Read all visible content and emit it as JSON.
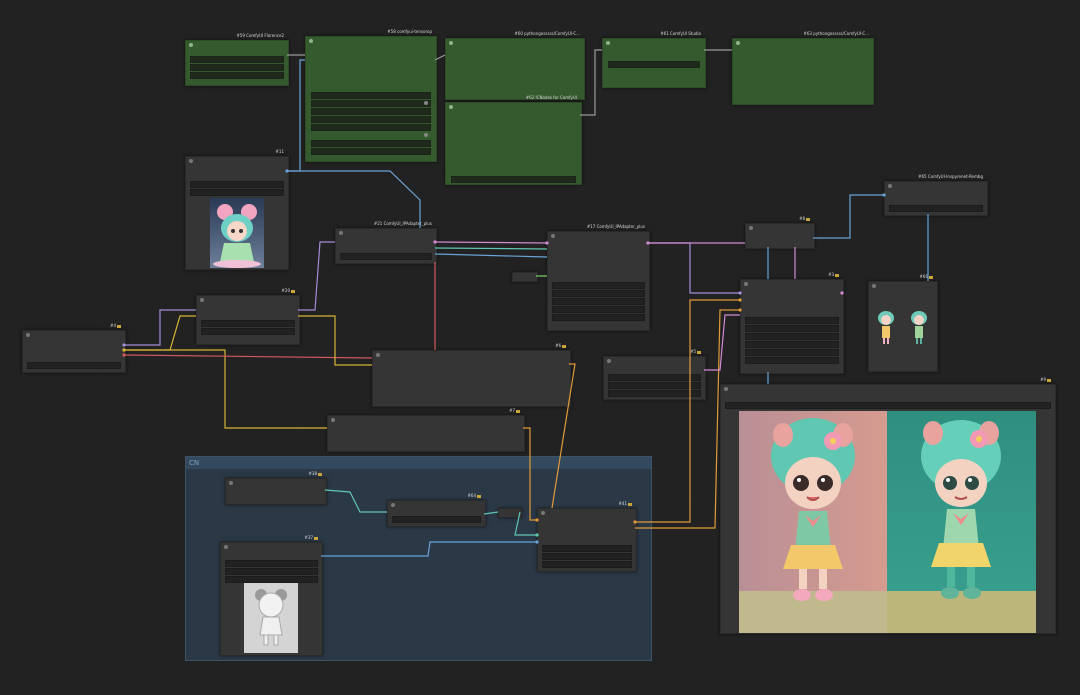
{
  "group": {
    "title": "CN"
  },
  "nodes": {
    "n59": {
      "title": "#59 ComfyUI Florence2"
    },
    "n58": {
      "title": "#58 comfyui-tensorop"
    },
    "n60": {
      "title": "#60 pythongosssss/ComfyUI-C..."
    },
    "n61": {
      "title": "#61 ComfyUI Studio"
    },
    "n63": {
      "title": "#63 pythongosssss/ComfyUI-C..."
    },
    "n62": {
      "title": "#62 ICNodes for ComfyUI"
    },
    "n11": {
      "title": "#11"
    },
    "n21": {
      "title": "#21 ComfyUI_IPAdapter_plus"
    },
    "n17": {
      "title": "#17 ComfyUI_IPAdapter_plus"
    },
    "n8": {
      "title": "#8"
    },
    "n65": {
      "title": "#65 ComfyUI-Inspyrenet-Rembg"
    },
    "n3": {
      "title": "#3"
    },
    "n66": {
      "title": "#66"
    },
    "n20": {
      "title": "#20"
    },
    "n4": {
      "title": "#4"
    },
    "n6": {
      "title": "#6"
    },
    "n5": {
      "title": "#5"
    },
    "n7": {
      "title": "#7"
    },
    "n9": {
      "title": "#9"
    },
    "n38": {
      "title": "#38"
    },
    "n64": {
      "title": "#64"
    },
    "n41": {
      "title": "#41"
    },
    "n37": {
      "title": "#37"
    }
  },
  "colors": {
    "canvas": "#222222",
    "node": "#353535",
    "green_node": "#355a2e",
    "group": "#2b3947",
    "wire_blue": "#6aa3d8",
    "wire_pink": "#d38ad6",
    "wire_purple": "#a58cd8",
    "wire_orange": "#e09a3a",
    "wire_yellow": "#d6b436",
    "wire_red": "#d05a5a",
    "wire_teal": "#5fc6b3",
    "wire_grey": "#9a9a9a",
    "wire_green": "#7ccf6a"
  },
  "icons": {
    "collapse": "circle-dot-icon",
    "pin": "pin-badge-icon"
  }
}
